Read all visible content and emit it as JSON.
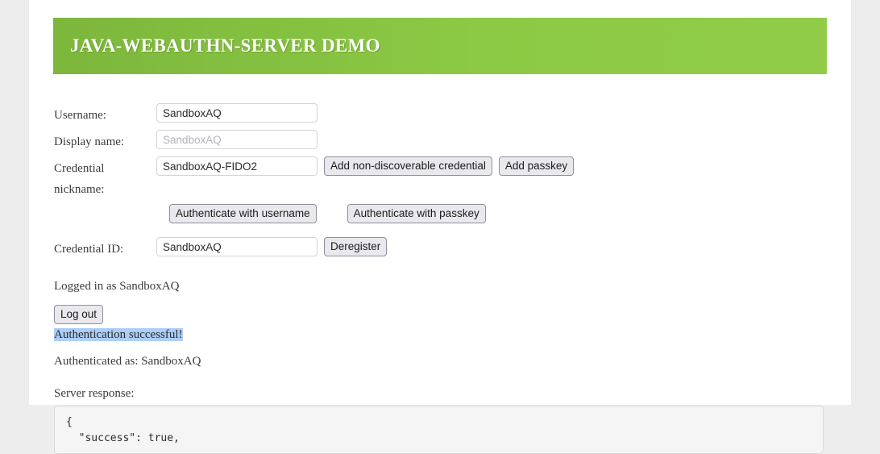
{
  "banner": {
    "title": "JAVA-WEBAUTHN-SERVER DEMO",
    "background_color": "#8cc944",
    "text_color": "#ffffff"
  },
  "form": {
    "username": {
      "label": "Username:",
      "value": "SandboxAQ",
      "placeholder": ""
    },
    "display_name": {
      "label": "Display name:",
      "value": "",
      "placeholder": "SandboxAQ"
    },
    "credential_nickname": {
      "label": "Credential nickname:",
      "value": "SandboxAQ-FIDO2",
      "placeholder": ""
    },
    "credential_id": {
      "label": "Credential ID:",
      "value": "SandboxAQ",
      "placeholder": ""
    }
  },
  "buttons": {
    "add_non_discoverable": "Add non-discoverable credential",
    "add_passkey": "Add passkey",
    "authenticate_with_username": "Authenticate with username",
    "authenticate_with_passkey": "Authenticate with passkey",
    "deregister": "Deregister",
    "log_out": "Log out"
  },
  "status": {
    "logged_in": "Logged in as SandboxAQ",
    "auth_result": "Authentication successful!",
    "auth_result_highlight_color": "#accef7",
    "authenticated_as": "Authenticated as: SandboxAQ"
  },
  "server_response": {
    "label": "Server response:",
    "body": "{\n  \"success\": true,"
  }
}
